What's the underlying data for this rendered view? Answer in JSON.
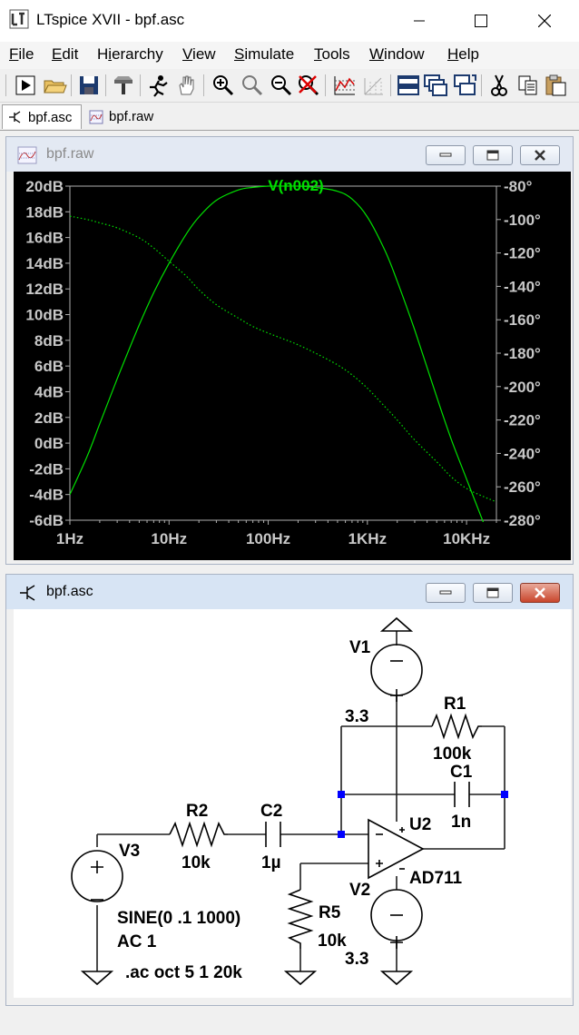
{
  "window": {
    "title": "LTspice XVII - bpf.asc"
  },
  "menu": [
    "File",
    "Edit",
    "Hierarchy",
    "View",
    "Simulate",
    "Tools",
    "Window",
    "Help"
  ],
  "menu_hotkeys": [
    "F",
    "E",
    "i",
    "V",
    "S",
    "T",
    "W",
    "H"
  ],
  "toolbar_icons": [
    "run-icon",
    "open-icon",
    "save-icon",
    "control-panel-icon",
    "halt-icon",
    "pan-icon",
    "zoom-in-icon",
    "zoom-area-icon",
    "zoom-out-icon",
    "zoom-cancel-icon",
    "autorange-icon",
    "grid-icon",
    "tile-horizontal-icon",
    "cascade-icon",
    "tile-vertical-icon",
    "cut-icon",
    "copy-icon",
    "paste-icon"
  ],
  "tabs": [
    {
      "label": "bpf.asc",
      "icon": "schematic-icon",
      "active": true
    },
    {
      "label": "bpf.raw",
      "icon": "waveform-icon",
      "active": false
    }
  ],
  "plot_window": {
    "title": "bpf.raw"
  },
  "schematic_window": {
    "title": "bpf.asc"
  },
  "chart_data": {
    "type": "line",
    "title": "",
    "trace_label": "V(n002)",
    "trace_color": "#00e000",
    "xscale": "log",
    "xlim": [
      1,
      20000
    ],
    "xticks": [
      "1Hz",
      "10Hz",
      "100Hz",
      "1KHz",
      "10KHz"
    ],
    "xtick_values": [
      1,
      10,
      100,
      1000,
      10000
    ],
    "ylim_left": [
      -6,
      20
    ],
    "yticks_left": [
      "20dB",
      "18dB",
      "16dB",
      "14dB",
      "12dB",
      "10dB",
      "8dB",
      "6dB",
      "4dB",
      "2dB",
      "0dB",
      "-2dB",
      "-4dB",
      "-6dB"
    ],
    "ylim_right": [
      -280,
      -80
    ],
    "yticks_right": [
      "-80°",
      "-100°",
      "-120°",
      "-140°",
      "-160°",
      "-180°",
      "-200°",
      "-220°",
      "-240°",
      "-260°",
      "-280°"
    ],
    "series": [
      {
        "name": "V(n002)",
        "axis": "left",
        "style": "solid",
        "x": [
          1,
          1.5,
          2,
          3,
          5,
          7,
          10,
          15,
          20,
          30,
          50,
          70,
          100,
          150,
          200,
          300,
          500,
          700,
          1000,
          1500,
          2000,
          3000,
          5000,
          7000,
          10000,
          15000,
          20000
        ],
        "y": [
          -4.0,
          -1.0,
          1.5,
          5.0,
          9.2,
          11.7,
          14.0,
          16.3,
          17.6,
          18.9,
          19.7,
          19.9,
          20.0,
          20.0,
          20.0,
          19.9,
          19.6,
          19.0,
          17.6,
          15.0,
          12.6,
          8.8,
          3.6,
          0.3,
          -2.8,
          -6.3,
          -8.8
        ]
      },
      {
        "name": "phase",
        "axis": "right",
        "style": "dotted",
        "x": [
          1,
          1.5,
          2,
          3,
          5,
          7,
          10,
          15,
          20,
          30,
          50,
          70,
          100,
          150,
          200,
          300,
          500,
          700,
          1000,
          1500,
          2000,
          3000,
          5000,
          7000,
          10000,
          15000,
          20000
        ],
        "y": [
          -98,
          -100,
          -102,
          -105,
          -111,
          -117,
          -125,
          -134,
          -142,
          -151,
          -159,
          -164,
          -168,
          -172,
          -175,
          -180,
          -187,
          -193,
          -201,
          -212,
          -220,
          -232,
          -245,
          -254,
          -261,
          -266,
          -269
        ]
      }
    ]
  },
  "schematic": {
    "labels": {
      "v1": "V1",
      "v1_value": "3.3",
      "v2": "V2",
      "v2_value": "3.3",
      "v3": "V3",
      "v3_value": "SINE(0 .1 1000)",
      "v3_ac": "AC 1",
      "r1": "R1",
      "r1_value": "100k",
      "r2": "R2",
      "r2_value": "10k",
      "r5": "R5",
      "r5_value": "10k",
      "c1": "C1",
      "c1_value": "1n",
      "c2": "C2",
      "c2_value": "1µ",
      "u2": "U2",
      "u2_value": "AD711",
      "directive": ".ac oct 5 1 20k"
    },
    "wire_color": "#1e1e1e",
    "component_color": "#000000",
    "node_color": "#0000ff"
  }
}
